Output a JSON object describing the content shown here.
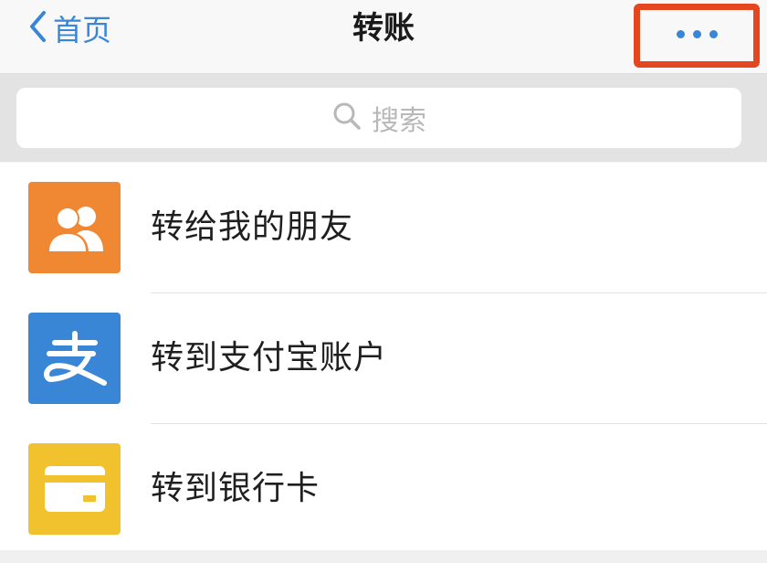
{
  "navbar": {
    "back_label": "首页",
    "title": "转账",
    "more_icon": "more-dots-icon",
    "accent_color": "#3a86d6",
    "highlight_color": "#e4471f"
  },
  "search": {
    "placeholder": "搜索",
    "icon": "search-icon"
  },
  "transfer_options": [
    {
      "label": "转给我的朋友",
      "icon": "friends-icon",
      "icon_color": "#ef8733"
    },
    {
      "label": "转到支付宝账户",
      "icon": "alipay-icon",
      "icon_color": "#3a86d6"
    },
    {
      "label": "转到银行卡",
      "icon": "bank-card-icon",
      "icon_color": "#f2c12e"
    }
  ]
}
